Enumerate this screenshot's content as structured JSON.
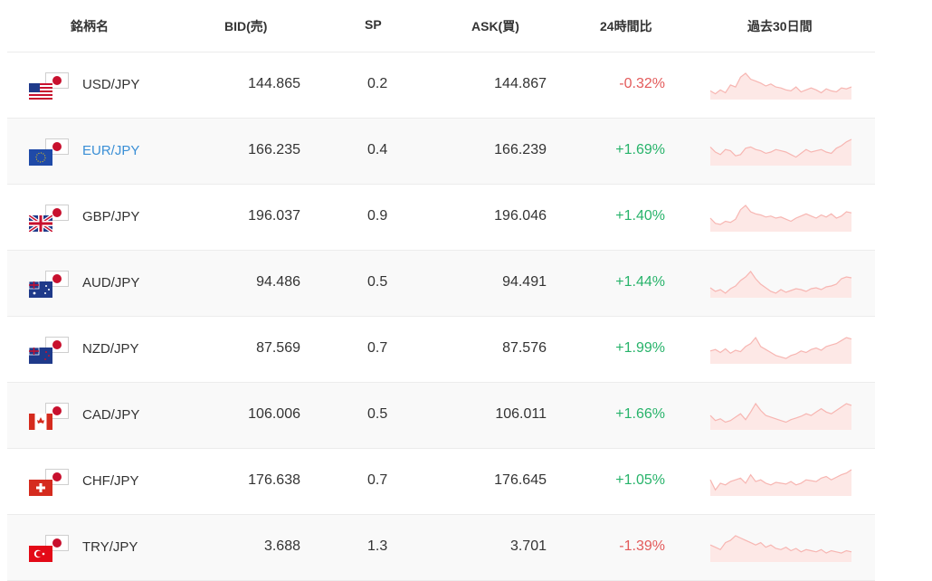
{
  "headers": {
    "name": "銘柄名",
    "bid": "BID(売)",
    "sp": "SP",
    "ask": "ASK(買)",
    "change": "24時間比",
    "history": "過去30日間"
  },
  "colors": {
    "positive": "#27b36a",
    "negative": "#e35a5a",
    "link": "#3a8fd6",
    "spark_line": "#f7b6b2",
    "spark_fill": "#fde8e6"
  },
  "rows": [
    {
      "pair": "USD/JPY",
      "flag": "us-flag-icon",
      "bid": "144.865",
      "sp": "0.2",
      "ask": "144.867",
      "change": "-0.32%",
      "trend": [
        8,
        5,
        9,
        6,
        14,
        12,
        22,
        26,
        20,
        18,
        16,
        13,
        15,
        12,
        11,
        9,
        8,
        12,
        7,
        9,
        11,
        9,
        6,
        10,
        8,
        7,
        11,
        10,
        12
      ]
    },
    {
      "pair": "EUR/JPY",
      "flag": "eu-flag-icon",
      "bid": "166.235",
      "sp": "0.4",
      "ask": "166.239",
      "change": "+1.69%",
      "trend": [
        14,
        10,
        8,
        12,
        11,
        7,
        8,
        13,
        14,
        12,
        11,
        9,
        10,
        12,
        11,
        10,
        8,
        6,
        9,
        12,
        10,
        11,
        12,
        10,
        9,
        13,
        15,
        18,
        20
      ]
    },
    {
      "pair": "GBP/JPY",
      "flag": "gb-flag-icon",
      "bid": "196.037",
      "sp": "0.9",
      "ask": "196.046",
      "change": "+1.40%",
      "trend": [
        12,
        7,
        6,
        9,
        8,
        11,
        20,
        24,
        18,
        16,
        15,
        13,
        14,
        12,
        13,
        11,
        9,
        12,
        14,
        16,
        14,
        12,
        15,
        13,
        16,
        12,
        14,
        18,
        17
      ]
    },
    {
      "pair": "AUD/JPY",
      "flag": "au-flag-icon",
      "bid": "94.486",
      "sp": "0.5",
      "ask": "94.491",
      "change": "+1.44%",
      "trend": [
        10,
        6,
        8,
        4,
        9,
        12,
        18,
        22,
        28,
        20,
        14,
        10,
        6,
        4,
        8,
        5,
        7,
        9,
        8,
        6,
        9,
        10,
        8,
        11,
        12,
        14,
        20,
        22,
        21
      ]
    },
    {
      "pair": "NZD/JPY",
      "flag": "nz-flag-icon",
      "bid": "87.569",
      "sp": "0.7",
      "ask": "87.576",
      "change": "+1.99%",
      "trend": [
        16,
        18,
        14,
        19,
        13,
        17,
        15,
        22,
        26,
        34,
        22,
        18,
        14,
        10,
        8,
        6,
        10,
        12,
        16,
        14,
        18,
        20,
        17,
        22,
        24,
        26,
        30,
        34,
        32
      ]
    },
    {
      "pair": "CAD/JPY",
      "flag": "ca-flag-icon",
      "bid": "106.006",
      "sp": "0.5",
      "ask": "106.011",
      "change": "+1.66%",
      "trend": [
        16,
        10,
        12,
        8,
        10,
        14,
        18,
        11,
        20,
        30,
        22,
        16,
        14,
        12,
        10,
        8,
        11,
        13,
        15,
        18,
        16,
        20,
        24,
        20,
        18,
        22,
        26,
        30,
        28
      ]
    },
    {
      "pair": "CHF/JPY",
      "flag": "ch-flag-icon",
      "bid": "176.638",
      "sp": "0.7",
      "ask": "176.645",
      "change": "+1.05%",
      "trend": [
        18,
        6,
        14,
        12,
        16,
        18,
        20,
        14,
        24,
        16,
        18,
        14,
        12,
        15,
        14,
        13,
        16,
        12,
        14,
        18,
        17,
        16,
        20,
        22,
        18,
        21,
        24,
        26,
        30
      ]
    },
    {
      "pair": "TRY/JPY",
      "flag": "tr-flag-icon",
      "bid": "3.688",
      "sp": "1.3",
      "ask": "3.701",
      "change": "-1.39%",
      "trend": [
        14,
        12,
        10,
        16,
        18,
        22,
        20,
        18,
        16,
        14,
        16,
        12,
        14,
        11,
        10,
        12,
        9,
        11,
        8,
        10,
        9,
        8,
        10,
        7,
        9,
        8,
        7,
        9,
        8
      ]
    }
  ]
}
